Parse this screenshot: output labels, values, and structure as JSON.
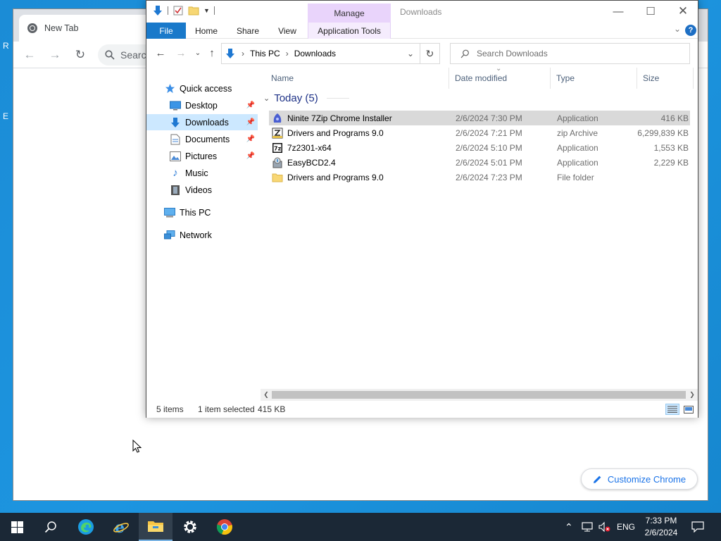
{
  "desktop": {
    "fragments": [
      "R",
      "E"
    ]
  },
  "chrome": {
    "tab_title": "New Tab",
    "search_placeholder": "Search G",
    "customize_label": "Customize Chrome",
    "accent_color": "#1a73e8"
  },
  "explorer": {
    "title": "Downloads",
    "manage_label": "Manage",
    "ribbon_tabs": [
      "File",
      "Home",
      "Share",
      "View",
      "Application Tools"
    ],
    "breadcrumb": [
      "This PC",
      "Downloads"
    ],
    "search_placeholder": "Search Downloads",
    "nav_pane": {
      "items": [
        {
          "label": "Quick access",
          "icon": "star-icon"
        },
        {
          "label": "Desktop",
          "icon": "desktop-icon",
          "pinned": true
        },
        {
          "label": "Downloads",
          "icon": "download-arrow-icon",
          "pinned": true,
          "selected": true
        },
        {
          "label": "Documents",
          "icon": "document-icon",
          "pinned": true
        },
        {
          "label": "Pictures",
          "icon": "picture-icon",
          "pinned": true
        },
        {
          "label": "Music",
          "icon": "music-note-icon"
        },
        {
          "label": "Videos",
          "icon": "film-icon"
        },
        {
          "label": "This PC",
          "icon": "computer-icon"
        },
        {
          "label": "Network",
          "icon": "network-icon"
        }
      ]
    },
    "columns": [
      "Name",
      "Date modified",
      "Type",
      "Size"
    ],
    "group_label": "Today (5)",
    "files": [
      {
        "name": "Ninite 7Zip Chrome Installer",
        "date": "2/6/2024 7:30 PM",
        "type": "Application",
        "size": "416 KB",
        "icon": "ninite-icon",
        "selected": true
      },
      {
        "name": "Drivers and Programs 9.0",
        "date": "2/6/2024 7:21 PM",
        "type": "zip Archive",
        "size": "6,299,839 KB",
        "icon": "zip-archive-icon"
      },
      {
        "name": "7z2301-x64",
        "date": "2/6/2024 5:10 PM",
        "type": "Application",
        "size": "1,553 KB",
        "icon": "7zip-icon"
      },
      {
        "name": "EasyBCD2.4",
        "date": "2/6/2024 5:01 PM",
        "type": "Application",
        "size": "2,229 KB",
        "icon": "installer-icon"
      },
      {
        "name": "Drivers and Programs 9.0",
        "date": "2/6/2024 7:23 PM",
        "type": "File folder",
        "size": "",
        "icon": "folder-icon"
      }
    ],
    "status": {
      "item_count": "5 items",
      "selection": "1 item selected",
      "selection_size": "415 KB"
    }
  },
  "taskbar": {
    "apps": [
      "start-icon",
      "search-icon",
      "edge-icon",
      "internet-explorer-icon",
      "file-explorer-icon",
      "settings-icon",
      "chrome-icon"
    ],
    "language": "ENG",
    "time": "7:33 PM",
    "date": "2/6/2024"
  }
}
